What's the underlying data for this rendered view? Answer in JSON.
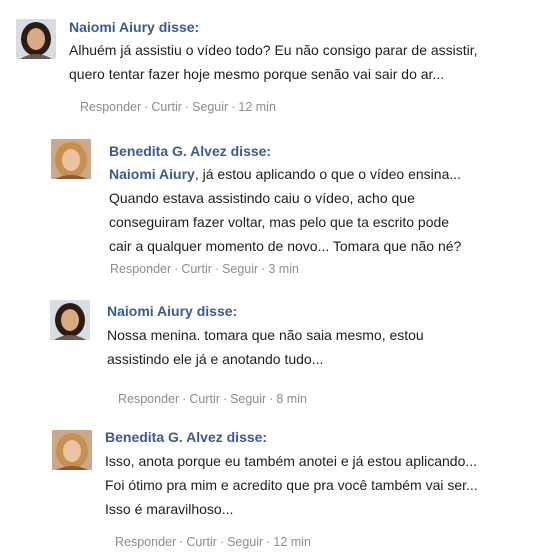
{
  "comments": [
    {
      "author": "Naiomi Aiury disse:",
      "mention": "",
      "lines": [
        "Alhuém já assistiu o vídeo todo? Eu não consigo parar de assistir,",
        "quero tentar fazer hoje mesmo porque senão vai sair do ar..."
      ],
      "actions": {
        "reply": "Responder",
        "like": "Curtir",
        "follow": "Seguir",
        "time": "12 min"
      },
      "avatar": "woman-dark-hair"
    },
    {
      "author": "Benedita G. Alvez disse:",
      "mention": "Naiomi Aiury",
      "lines": [
        ", já estou aplicando o que o vídeo ensina...",
        "Quando estava assistindo caiu o vídeo, acho que",
        "conseguiram fazer voltar, mas pelo que ta escrito pode",
        "cair a qualquer momento de novo... Tomara que não né?"
      ],
      "actions": {
        "reply": "Responder",
        "like": "Curtir",
        "follow": "Seguir",
        "time": "3 min"
      },
      "avatar": "woman-blonde-hair"
    },
    {
      "author": "Naiomi Aiury disse:",
      "mention": "",
      "lines": [
        "Nossa menina. tomara que não saia mesmo, estou",
        "assistindo ele já e anotando tudo..."
      ],
      "actions": {
        "reply": "Responder",
        "like": "Curtir",
        "follow": "Seguir",
        "time": "8 min"
      },
      "avatar": "woman-dark-hair"
    },
    {
      "author": "Benedita G. Alvez disse:",
      "mention": "",
      "lines": [
        "Isso, anota porque eu também anotei e já estou aplicando...",
        "Foi ótimo pra mim e acredito que pra você também vai ser...",
        "Isso é maravilhoso..."
      ],
      "actions": {
        "reply": "Responder",
        "like": "Curtir",
        "follow": "Seguir",
        "time": "12 min"
      },
      "avatar": "woman-blonde-hair"
    }
  ],
  "separator": " · "
}
